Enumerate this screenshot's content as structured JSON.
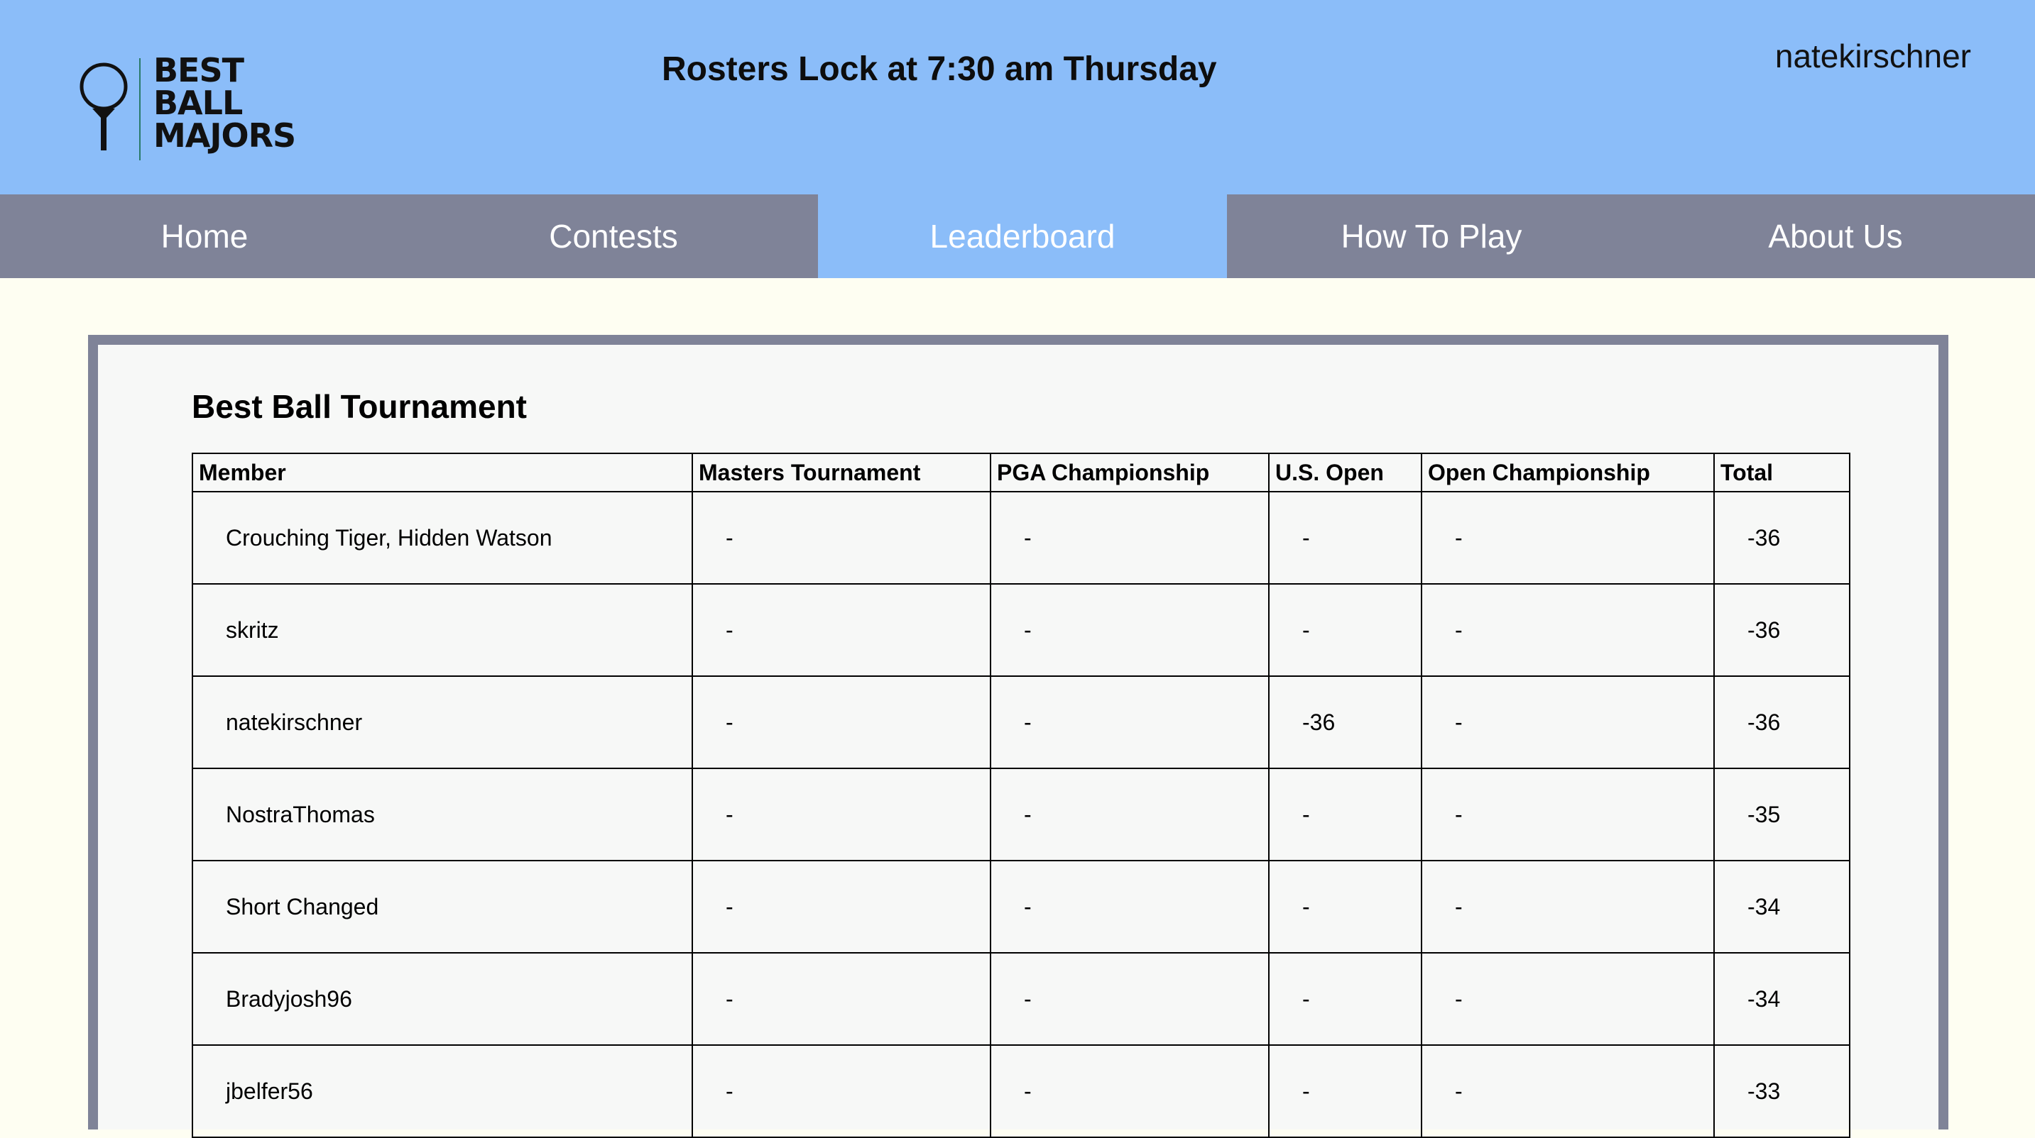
{
  "header": {
    "logo": {
      "lines": [
        "BEST",
        "BALL",
        "MAJORS"
      ],
      "icon": "golf-ball-on-tee-icon"
    },
    "announcement": "Rosters Lock at 7:30 am Thursday",
    "username": "natekirschner"
  },
  "nav": {
    "items": [
      {
        "label": "Home",
        "active": false
      },
      {
        "label": "Contests",
        "active": false
      },
      {
        "label": "Leaderboard",
        "active": true
      },
      {
        "label": "How To Play",
        "active": false
      },
      {
        "label": "About Us",
        "active": false
      }
    ]
  },
  "leaderboard": {
    "title": "Best Ball Tournament",
    "columns": [
      "Member",
      "Masters Tournament",
      "PGA Championship",
      "U.S. Open",
      "Open Championship",
      "Total"
    ],
    "rows": [
      [
        "Crouching Tiger, Hidden Watson",
        "-",
        "-",
        "-",
        "-",
        "-36"
      ],
      [
        "skritz",
        "-",
        "-",
        "-",
        "-",
        "-36"
      ],
      [
        "natekirschner",
        "-",
        "-",
        "-36",
        "-",
        "-36"
      ],
      [
        "NostraThomas",
        "-",
        "-",
        "-",
        "-",
        "-35"
      ],
      [
        "Short Changed",
        "-",
        "-",
        "-",
        "-",
        "-34"
      ],
      [
        "Bradyjosh96",
        "-",
        "-",
        "-",
        "-",
        "-34"
      ],
      [
        "jbelfer56",
        "-",
        "-",
        "-",
        "-",
        "-33"
      ]
    ]
  },
  "colors": {
    "header_bg": "#8bbdf9",
    "nav_bg": "#7f8398",
    "nav_active_bg": "#8bbdf9",
    "page_bg": "#fefef2",
    "panel_bg": "#f7f8f7"
  }
}
